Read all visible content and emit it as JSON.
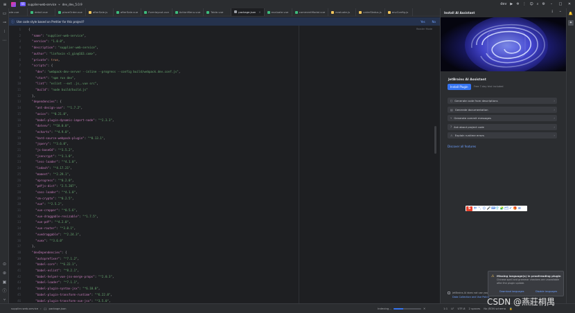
{
  "titlebar": {
    "project_badge": "SS",
    "project_name": "supplier-web-service",
    "branch": "dev_dev_5.0.9",
    "right_user": "dev"
  },
  "tabs": [
    {
      "label": "code.vue",
      "color": "#3dbb7c"
    },
    {
      "label": "detail.vue",
      "color": "#3dbb7c"
    },
    {
      "label": "placeOrder.vue",
      "color": "#3dbb7c"
    },
    {
      "label": "afterSale.js",
      "color": "#f2c55c"
    },
    {
      "label": "afterSale.vue",
      "color": "#3dbb7c"
    },
    {
      "label": "Formlayout.vue",
      "color": "#3dbb7c"
    },
    {
      "label": "ActionMenu.vue",
      "color": "#3dbb7c"
    },
    {
      "label": "Table.vue",
      "color": "#3dbb7c"
    },
    {
      "label": "package.json",
      "color": "#9da0a8",
      "active": true
    },
    {
      "label": "evaluate.vue",
      "color": "#3dbb7c"
    },
    {
      "label": "commentModal.vue",
      "color": "#3dbb7c"
    },
    {
      "label": "evaluate.js",
      "color": "#f2c55c"
    },
    {
      "label": "orderStatus.js",
      "color": "#f2c55c"
    },
    {
      "label": "envConfig.js",
      "color": "#f2c55c"
    }
  ],
  "banner": {
    "text": "Use code style based on Prettier for this project?",
    "yes": "Yes",
    "no": "No"
  },
  "editor": {
    "reader_mode": "Reader Mode",
    "lines": [
      [
        [
          "p",
          "{"
        ]
      ],
      [
        [
          "p",
          "  "
        ],
        [
          "k",
          "\"name\""
        ],
        [
          "p",
          ": "
        ],
        [
          "s",
          "\"supplier-web-service\""
        ],
        [
          "p",
          ","
        ]
      ],
      [
        [
          "p",
          "  "
        ],
        [
          "k",
          "\"version\""
        ],
        [
          "p",
          ": "
        ],
        [
          "s",
          "\"1.0.0\""
        ],
        [
          "p",
          ","
        ]
      ],
      [
        [
          "p",
          "  "
        ],
        [
          "k",
          "\"description\""
        ],
        [
          "p",
          ": "
        ],
        [
          "s",
          "\"supplier-web-service\""
        ],
        [
          "p",
          ","
        ]
      ],
      [
        [
          "p",
          "  "
        ],
        [
          "k",
          "\"author\""
        ],
        [
          "p",
          ": "
        ],
        [
          "s",
          "\"linfoxin <l_gin@163.com>\""
        ],
        [
          "p",
          ","
        ]
      ],
      [
        [
          "p",
          "  "
        ],
        [
          "k",
          "\"private\""
        ],
        [
          "p",
          ": "
        ],
        [
          "kw",
          "true"
        ],
        [
          "p",
          ","
        ]
      ],
      [
        [
          "p",
          "  "
        ],
        [
          "k",
          "\"scripts\""
        ],
        [
          "p",
          ": {"
        ]
      ],
      [
        [
          "p",
          "    "
        ],
        [
          "k",
          "\"dev\""
        ],
        [
          "p",
          ": "
        ],
        [
          "s",
          "\"webpack-dev-server --inline --progress --config build/webpack.dev.conf.js\""
        ],
        [
          "p",
          ","
        ]
      ],
      [
        [
          "p",
          "    "
        ],
        [
          "k",
          "\"start\""
        ],
        [
          "p",
          ": "
        ],
        [
          "s",
          "\"npm run dev\""
        ],
        [
          "p",
          ","
        ]
      ],
      [
        [
          "p",
          "    "
        ],
        [
          "k",
          "\"lint\""
        ],
        [
          "p",
          ": "
        ],
        [
          "s",
          "\"eslint --ext .js,.vue src\""
        ],
        [
          "p",
          ","
        ]
      ],
      [
        [
          "p",
          "    "
        ],
        [
          "k",
          "\"build\""
        ],
        [
          "p",
          ": "
        ],
        [
          "s",
          "\"node build/build.js\""
        ]
      ],
      [
        [
          "p",
          "  },"
        ]
      ],
      [
        [
          "p",
          "  "
        ],
        [
          "k",
          "\"dependencies\""
        ],
        [
          "p",
          ": {"
        ]
      ],
      [
        [
          "p",
          "    "
        ],
        [
          "k",
          "\"ant-design-vue\""
        ],
        [
          "p",
          ": "
        ],
        [
          "s",
          "\"^1.7.2\""
        ],
        [
          "p",
          ","
        ]
      ],
      [
        [
          "p",
          "    "
        ],
        [
          "k",
          "\"axios\""
        ],
        [
          "p",
          ": "
        ],
        [
          "s",
          "\"^0.21.0\""
        ],
        [
          "p",
          ","
        ]
      ],
      [
        [
          "p",
          "    "
        ],
        [
          "k",
          "\"babel-plugin-dynamic-import-node\""
        ],
        [
          "p",
          ": "
        ],
        [
          "s",
          "\"^2.3.3\""
        ],
        [
          "p",
          ","
        ]
      ],
      [
        [
          "p",
          "    "
        ],
        [
          "k",
          "\"dotenv\""
        ],
        [
          "p",
          ": "
        ],
        [
          "s",
          "\"^10.0.0\""
        ],
        [
          "p",
          ","
        ]
      ],
      [
        [
          "p",
          "    "
        ],
        [
          "k",
          "\"echarts\""
        ],
        [
          "p",
          ": "
        ],
        [
          "s",
          "\"^4.9.0\""
        ],
        [
          "p",
          ","
        ]
      ],
      [
        [
          "p",
          "    "
        ],
        [
          "k",
          "\"hard-source-webpack-plugin\""
        ],
        [
          "p",
          ": "
        ],
        [
          "s",
          "\"^0.13.1\""
        ],
        [
          "p",
          ","
        ]
      ],
      [
        [
          "p",
          "    "
        ],
        [
          "k",
          "\"jquery\""
        ],
        [
          "p",
          ": "
        ],
        [
          "s",
          "\"^3.6.0\""
        ],
        [
          "p",
          ","
        ]
      ],
      [
        [
          "p",
          "    "
        ],
        [
          "k",
          "\"js-base64\""
        ],
        [
          "p",
          ": "
        ],
        [
          "s",
          "\"^3.5.2\""
        ],
        [
          "p",
          ","
        ]
      ],
      [
        [
          "p",
          "    "
        ],
        [
          "k",
          "\"jsencrypt\""
        ],
        [
          "p",
          ": "
        ],
        [
          "s",
          "\"^3.1.0\""
        ],
        [
          "p",
          ","
        ]
      ],
      [
        [
          "p",
          "    "
        ],
        [
          "k",
          "\"less-loader\""
        ],
        [
          "p",
          ": "
        ],
        [
          "s",
          "\"^4.1.0\""
        ],
        [
          "p",
          ","
        ]
      ],
      [
        [
          "p",
          "    "
        ],
        [
          "k",
          "\"lodash\""
        ],
        [
          "p",
          ": "
        ],
        [
          "s",
          "\"^4.17.21\""
        ],
        [
          "p",
          ","
        ]
      ],
      [
        [
          "p",
          "    "
        ],
        [
          "k",
          "\"moment\""
        ],
        [
          "p",
          ": "
        ],
        [
          "s",
          "\"^2.29.1\""
        ],
        [
          "p",
          ","
        ]
      ],
      [
        [
          "p",
          "    "
        ],
        [
          "k",
          "\"nprogress\""
        ],
        [
          "p",
          ": "
        ],
        [
          "s",
          "\"^0.2.0\""
        ],
        [
          "p",
          ","
        ]
      ],
      [
        [
          "p",
          "    "
        ],
        [
          "k",
          "\"pdfjs-dist\""
        ],
        [
          "p",
          ": "
        ],
        [
          "s",
          "\"2.5.207\""
        ],
        [
          "p",
          ","
        ]
      ],
      [
        [
          "p",
          "    "
        ],
        [
          "k",
          "\"sass-loader\""
        ],
        [
          "p",
          ": "
        ],
        [
          "s",
          "\"^4.1.0\""
        ],
        [
          "p",
          ","
        ]
      ],
      [
        [
          "p",
          "    "
        ],
        [
          "k",
          "\"sm-crypto\""
        ],
        [
          "p",
          ": "
        ],
        [
          "s",
          "\"^0.2.5\""
        ],
        [
          "p",
          ","
        ]
      ],
      [
        [
          "p",
          "    "
        ],
        [
          "k",
          "\"vue\""
        ],
        [
          "p",
          ": "
        ],
        [
          "s",
          "\"^2.5.2\""
        ],
        [
          "p",
          ","
        ]
      ],
      [
        [
          "p",
          "    "
        ],
        [
          "k",
          "\"vue-cropper\""
        ],
        [
          "p",
          ": "
        ],
        [
          "s",
          "\"^0.5.6\""
        ],
        [
          "p",
          ","
        ]
      ],
      [
        [
          "p",
          "    "
        ],
        [
          "k",
          "\"vue-draggable-resizable\""
        ],
        [
          "p",
          ": "
        ],
        [
          "s",
          "\"^1.7.5\""
        ],
        [
          "p",
          ","
        ]
      ],
      [
        [
          "p",
          "    "
        ],
        [
          "k",
          "\"vue-pdf\""
        ],
        [
          "p",
          ": "
        ],
        [
          "s",
          "\"^4.2.0\""
        ],
        [
          "p",
          ","
        ]
      ],
      [
        [
          "p",
          "    "
        ],
        [
          "k",
          "\"vue-router\""
        ],
        [
          "p",
          ": "
        ],
        [
          "s",
          "\"^3.0.1\""
        ],
        [
          "p",
          ","
        ]
      ],
      [
        [
          "p",
          "    "
        ],
        [
          "k",
          "\"vuedraggable\""
        ],
        [
          "p",
          ": "
        ],
        [
          "s",
          "\"^2.24.3\""
        ],
        [
          "p",
          ","
        ]
      ],
      [
        [
          "p",
          "    "
        ],
        [
          "k",
          "\"vuex\""
        ],
        [
          "p",
          ": "
        ],
        [
          "s",
          "\"^3.6.0\""
        ]
      ],
      [
        [
          "p",
          "  },"
        ]
      ],
      [
        [
          "p",
          "  "
        ],
        [
          "k",
          "\"devDependencies\""
        ],
        [
          "p",
          ": {"
        ]
      ],
      [
        [
          "p",
          "    "
        ],
        [
          "k",
          "\"autoprefixer\""
        ],
        [
          "p",
          ": "
        ],
        [
          "s",
          "\"^7.1.2\""
        ],
        [
          "p",
          ","
        ]
      ],
      [
        [
          "p",
          "    "
        ],
        [
          "k",
          "\"babel-core\""
        ],
        [
          "p",
          ": "
        ],
        [
          "s",
          "\"^6.22.1\""
        ],
        [
          "p",
          ","
        ]
      ],
      [
        [
          "p",
          "    "
        ],
        [
          "k",
          "\"babel-eslint\""
        ],
        [
          "p",
          ": "
        ],
        [
          "s",
          "\"^8.2.1\""
        ],
        [
          "p",
          ","
        ]
      ],
      [
        [
          "p",
          "    "
        ],
        [
          "k",
          "\"babel-helper-vue-jsx-merge-props\""
        ],
        [
          "p",
          ": "
        ],
        [
          "s",
          "\"^2.0.3\""
        ],
        [
          "p",
          ","
        ]
      ],
      [
        [
          "p",
          "    "
        ],
        [
          "k",
          "\"babel-loader\""
        ],
        [
          "p",
          ": "
        ],
        [
          "s",
          "\"^7.1.1\""
        ],
        [
          "p",
          ","
        ]
      ],
      [
        [
          "p",
          "    "
        ],
        [
          "k",
          "\"babel-plugin-syntax-jsx\""
        ],
        [
          "p",
          ": "
        ],
        [
          "s",
          "\"^6.18.0\""
        ],
        [
          "p",
          ","
        ]
      ],
      [
        [
          "p",
          "    "
        ],
        [
          "k",
          "\"babel-plugin-transform-runtime\""
        ],
        [
          "p",
          ": "
        ],
        [
          "s",
          "\"^6.22.0\""
        ],
        [
          "p",
          ","
        ]
      ],
      [
        [
          "p",
          "    "
        ],
        [
          "k",
          "\"babel-plugin-transform-vue-jsx\""
        ],
        [
          "p",
          ": "
        ],
        [
          "s",
          "\"^3.5.0\""
        ],
        [
          "p",
          ","
        ]
      ]
    ]
  },
  "ai": {
    "header": "Install AI Assistant",
    "title": "JetBrains AI Assistant",
    "install": "Install Plugin",
    "install_note": "Free 7-day trial included",
    "items": [
      "Generate code from descriptions",
      "Generate documentation",
      "Generate commit messages",
      "Ask about project code",
      "Explain runtime errors"
    ],
    "discover": "Discover all features",
    "footer": "JetBrains AI does not use your data",
    "footer_link": "Data Collection and Use Policy"
  },
  "popup": {
    "title": "Missing language(s) in proofreading plugin",
    "body": "Chinese spell and grammar checkers are unavailable after the plugin update.",
    "link1": "Download languages",
    "link2": "Disable languages"
  },
  "ime": {
    "logo": "S",
    "icons": [
      "中",
      "°,",
      "☺",
      "🎤",
      "⌨",
      "👕",
      "🧩",
      "🗂",
      "✔",
      "🎁",
      "⊞"
    ]
  },
  "statusbar": {
    "project": "supplier-web-service",
    "file": "package.json",
    "indexing": "Indexing...",
    "progress": 0.35,
    "position": "1:1",
    "line_sep": "LF",
    "encoding": "UTF-8",
    "indent": "2 spaces",
    "json_schema": "No JSON schema"
  },
  "watermark": "CSDN @燕莊桐禺",
  "colors": {
    "accent": "#3574f0",
    "link": "#6ea0ff",
    "json_key": "#c77dbb",
    "json_string": "#6aab73",
    "json_keyword": "#cf8e6d"
  }
}
